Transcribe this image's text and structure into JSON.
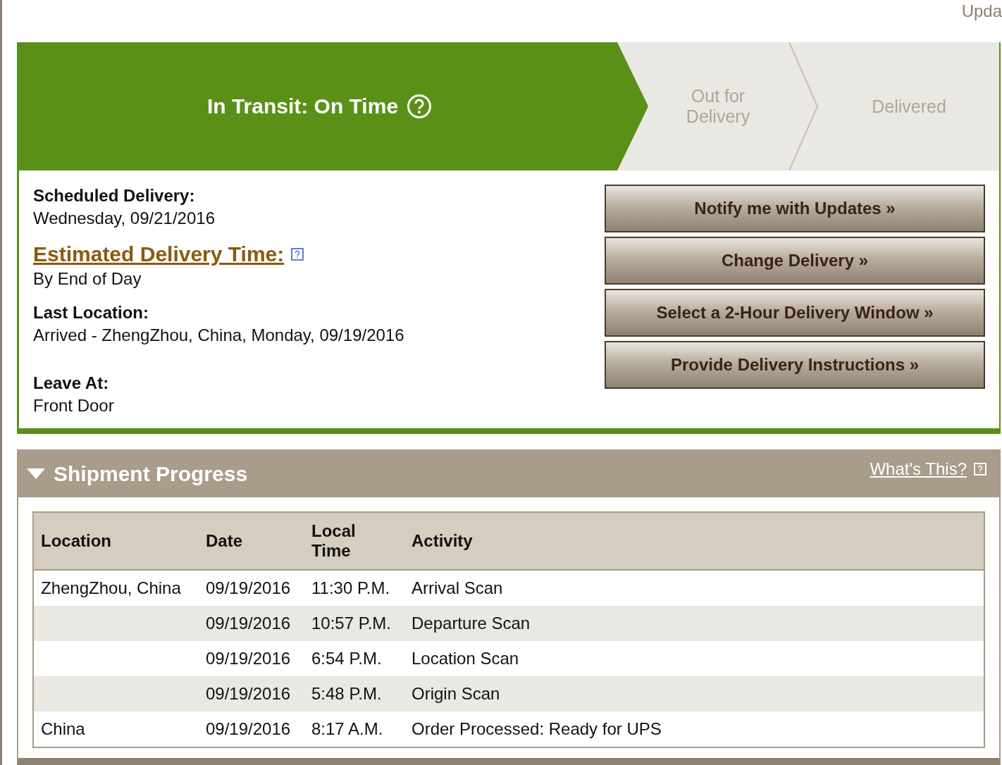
{
  "top_link": "Upda",
  "steps": [
    {
      "label": "In Transit: On Time",
      "current": true,
      "help": true
    },
    {
      "label": "Out for Delivery",
      "current": false,
      "help": false
    },
    {
      "label": "Delivered",
      "current": false,
      "help": false
    }
  ],
  "details": [
    {
      "label": "Scheduled Delivery:",
      "value": "Wednesday, 09/21/2016",
      "kind": "plain"
    },
    {
      "label": "Estimated Delivery Time:",
      "value": "By End of Day",
      "kind": "link"
    },
    {
      "label": "Last Location:",
      "value": "Arrived - ZhengZhou, China, Monday, 09/19/2016",
      "kind": "plain"
    },
    {
      "label": "Leave At:",
      "value": "Front Door",
      "kind": "spaced"
    }
  ],
  "buttons": [
    "Notify me with Updates »",
    "Change Delivery »",
    "Select a 2-Hour Delivery Window »",
    "Provide Delivery Instructions »"
  ],
  "progress": {
    "title": "Shipment Progress",
    "expanded": true,
    "help_link": "What's This?",
    "columns": [
      "Location",
      "Date",
      "Local Time",
      "Activity"
    ],
    "rows": [
      [
        "ZhengZhou, China",
        "09/19/2016",
        "11:30 P.M.",
        "Arrival Scan"
      ],
      [
        "",
        "09/19/2016",
        "10:57 P.M.",
        "Departure Scan"
      ],
      [
        "",
        "09/19/2016",
        "6:54 P.M.",
        "Location Scan"
      ],
      [
        "",
        "09/19/2016",
        "5:48 P.M.",
        "Origin Scan"
      ],
      [
        "China",
        "09/19/2016",
        "8:17 A.M.",
        "Order Processed: Ready for UPS"
      ]
    ]
  }
}
